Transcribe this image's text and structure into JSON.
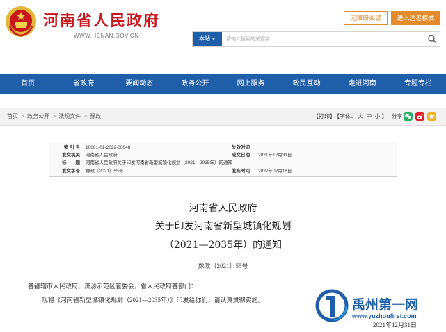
{
  "header": {
    "site_title": "河南省人民政府",
    "site_url": "WWW.HENAN.GOV.CN",
    "access_button": "无障碍阅读",
    "elder_button": "进入适老模式",
    "search": {
      "scope_label": "本站",
      "placeholder": "请输入搜索的关键字"
    }
  },
  "nav": {
    "items": [
      "首页",
      "省政府",
      "要闻动态",
      "政务公开",
      "网上服务",
      "政民互动",
      "走进河南",
      "专题专栏"
    ]
  },
  "breadcrumb": {
    "items": [
      "首页",
      "政务公开",
      "法规文件",
      "豫政"
    ],
    "separator": ">"
  },
  "tools": {
    "print": "【打印】",
    "font_prefix": "【字体：",
    "font_large": "大",
    "font_medium": "中",
    "font_small": "小",
    "font_suffix": "】",
    "share_label": "分享："
  },
  "info": {
    "index_label": "索 引 号",
    "index_value": "10001-01-2022-00048",
    "invalid_label": "失效时间",
    "invalid_value": "",
    "issuer_label": "发文机关",
    "issuer_value": "河南省人民政府",
    "created_label": "成文日期",
    "created_value": "2021年12月31日",
    "title_label": "标　　题",
    "title_value": "河南省人民政府关于印发河南省新型城镇化规划（2021—2035年）的通知",
    "docno_label": "发文字号",
    "docno_value": "豫政〔2021〕55号",
    "published_label": "发布时间",
    "published_value": "2022年02月16日"
  },
  "article": {
    "title_line1": "河南省人民政府",
    "title_line2": "关于印发河南省新型城镇化规划",
    "title_line3": "（2021—2035年）的通知",
    "doc_number": "豫政〔2021〕55号",
    "salutation": "各省辖市人民政府、济源示范区管委会，省人民政府各部门：",
    "body": "现将《河南省新型城镇化规划（2021—2035年）》印发给你们，请认真贯彻实施。",
    "date": "2021年12月31日"
  },
  "watermark": {
    "name": "禹州第一网",
    "url": "www.yuzhoufirst.com"
  },
  "colors": {
    "brand_red": "#c8161d",
    "nav_blue": "#1f5ea8",
    "accent_orange": "#e38a2c",
    "wechat_green": "#2aae67",
    "weibo_red": "#e6162d",
    "favorite_yellow": "#f3b21b"
  },
  "icons": {
    "emblem": "national-emblem-icon",
    "search": "search-icon",
    "wechat": "wechat-icon",
    "weibo": "weibo-icon",
    "favorite": "star-icon"
  }
}
